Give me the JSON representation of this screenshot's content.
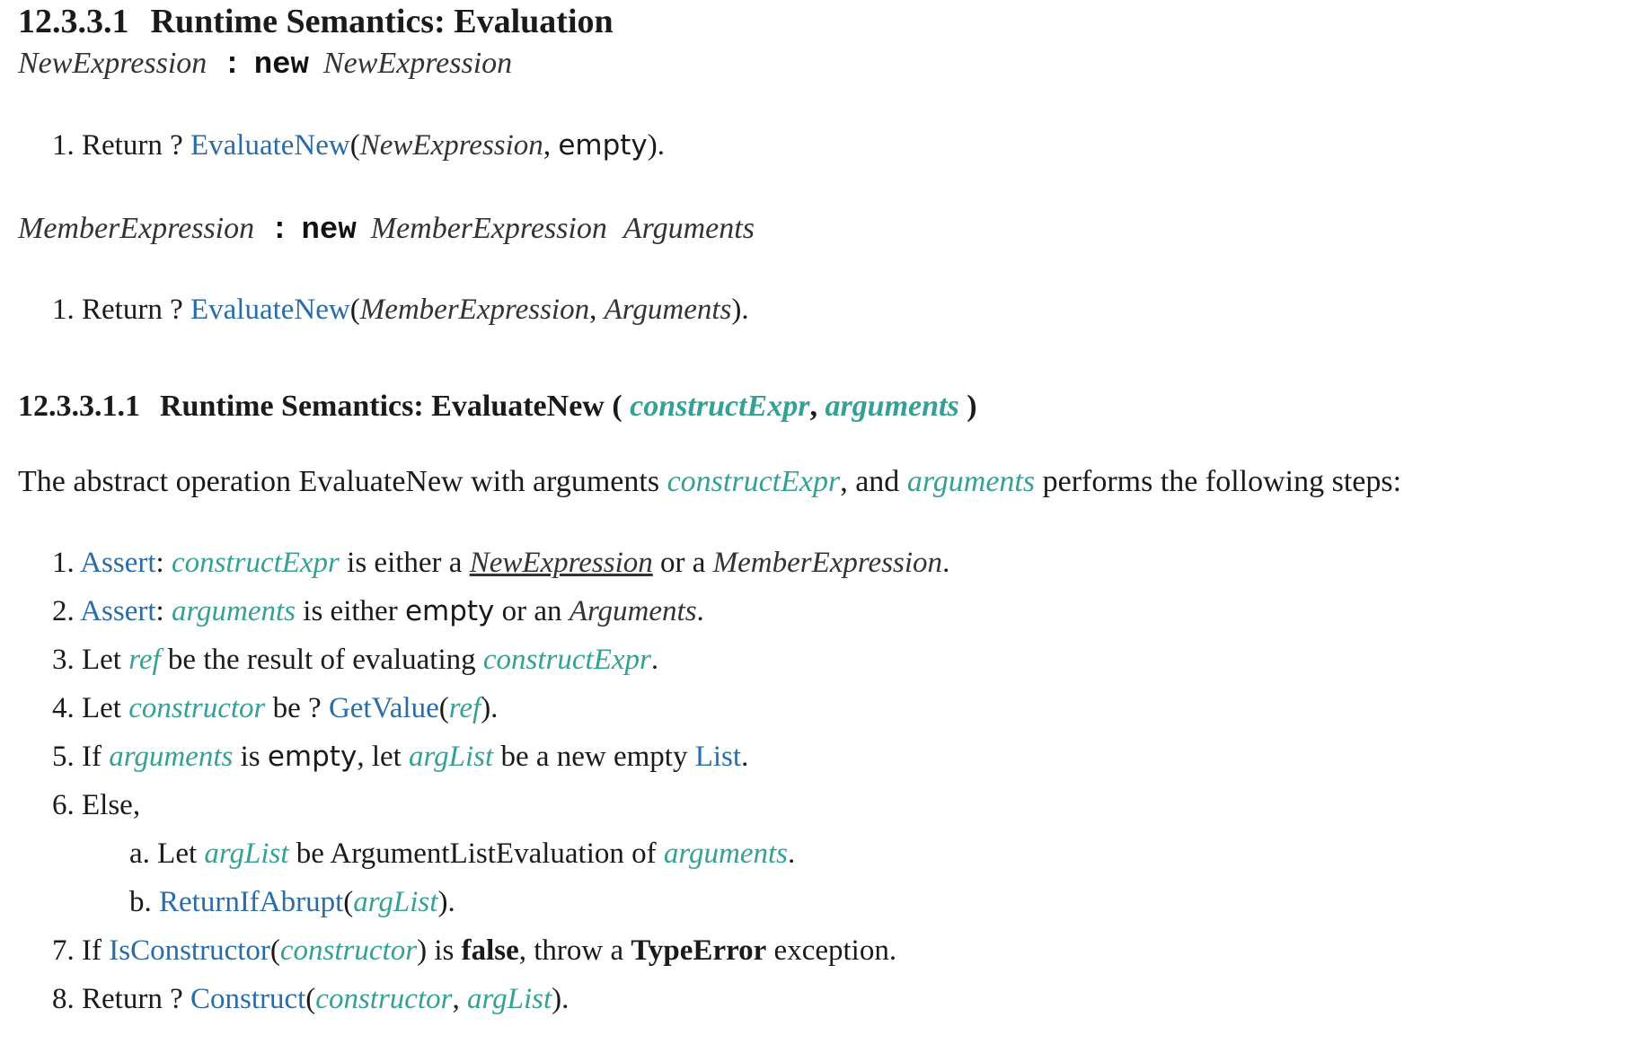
{
  "section": {
    "number": "12.3.3.1",
    "title": "Runtime Semantics: Evaluation"
  },
  "production1": {
    "lhs": "NewExpression",
    "colon": ":",
    "keyword": "new",
    "rhs": "NewExpression"
  },
  "production1_step": {
    "num": "1.",
    "text_return": "Return ?",
    "op": "EvaluateNew",
    "arg1": "NewExpression",
    "arg2": "empty"
  },
  "production2": {
    "lhs": "MemberExpression",
    "colon": ":",
    "keyword": "new",
    "rhs1": "MemberExpression",
    "rhs2": "Arguments"
  },
  "production2_step": {
    "num": "1.",
    "text_return": "Return ?",
    "op": "EvaluateNew",
    "arg1": "MemberExpression",
    "arg2": "Arguments"
  },
  "subsection": {
    "number": "12.3.3.1.1",
    "title": "Runtime Semantics: EvaluateNew (",
    "param1": "constructExpr",
    "param2": "arguments",
    "close": ")"
  },
  "intro": {
    "before": "The abstract operation EvaluateNew with arguments ",
    "param1": "constructExpr",
    "middle": ", and ",
    "param2": "arguments",
    "after": " performs the following steps:"
  },
  "steps": {
    "s1": {
      "num": "1.",
      "assert": "Assert",
      "var": "constructExpr",
      "t1": " is either a ",
      "nt1": "NewExpression",
      "t2": " or a ",
      "nt2": "MemberExpression",
      "t3": "."
    },
    "s2": {
      "num": "2.",
      "assert": "Assert",
      "var": "arguments",
      "t1": " is either ",
      "spec": "empty",
      "t2": " or an ",
      "nt": "Arguments",
      "t3": "."
    },
    "s3": {
      "num": "3.",
      "t1": "Let ",
      "var1": "ref",
      "t2": " be the result of evaluating ",
      "var2": "constructExpr",
      "t3": "."
    },
    "s4": {
      "num": "4.",
      "t1": "Let ",
      "var1": "constructor",
      "t2": " be ? ",
      "op": "GetValue",
      "var2": "ref"
    },
    "s5": {
      "num": "5.",
      "t1": "If ",
      "var1": "arguments",
      "t2": " is ",
      "spec": "empty",
      "t3": ", let ",
      "var2": "argList",
      "t4": " be a new empty ",
      "op": "List",
      "t5": "."
    },
    "s6": {
      "num": "6.",
      "t1": "Else,"
    },
    "s6a": {
      "num": "a.",
      "t1": "Let ",
      "var1": "argList",
      "t2": " be ArgumentListEvaluation of ",
      "var2": "arguments",
      "t3": "."
    },
    "s6b": {
      "num": "b.",
      "op": "ReturnIfAbrupt",
      "var": "argList"
    },
    "s7": {
      "num": "7.",
      "t1": "If ",
      "op": "IsConstructor",
      "var": "constructor",
      "t2": " is ",
      "b1": "false",
      "t3": ", throw a ",
      "b2": "TypeError",
      "t4": " exception."
    },
    "s8": {
      "num": "8.",
      "t1": "Return ? ",
      "op": "Construct",
      "var1": "constructor",
      "var2": "argList"
    }
  }
}
